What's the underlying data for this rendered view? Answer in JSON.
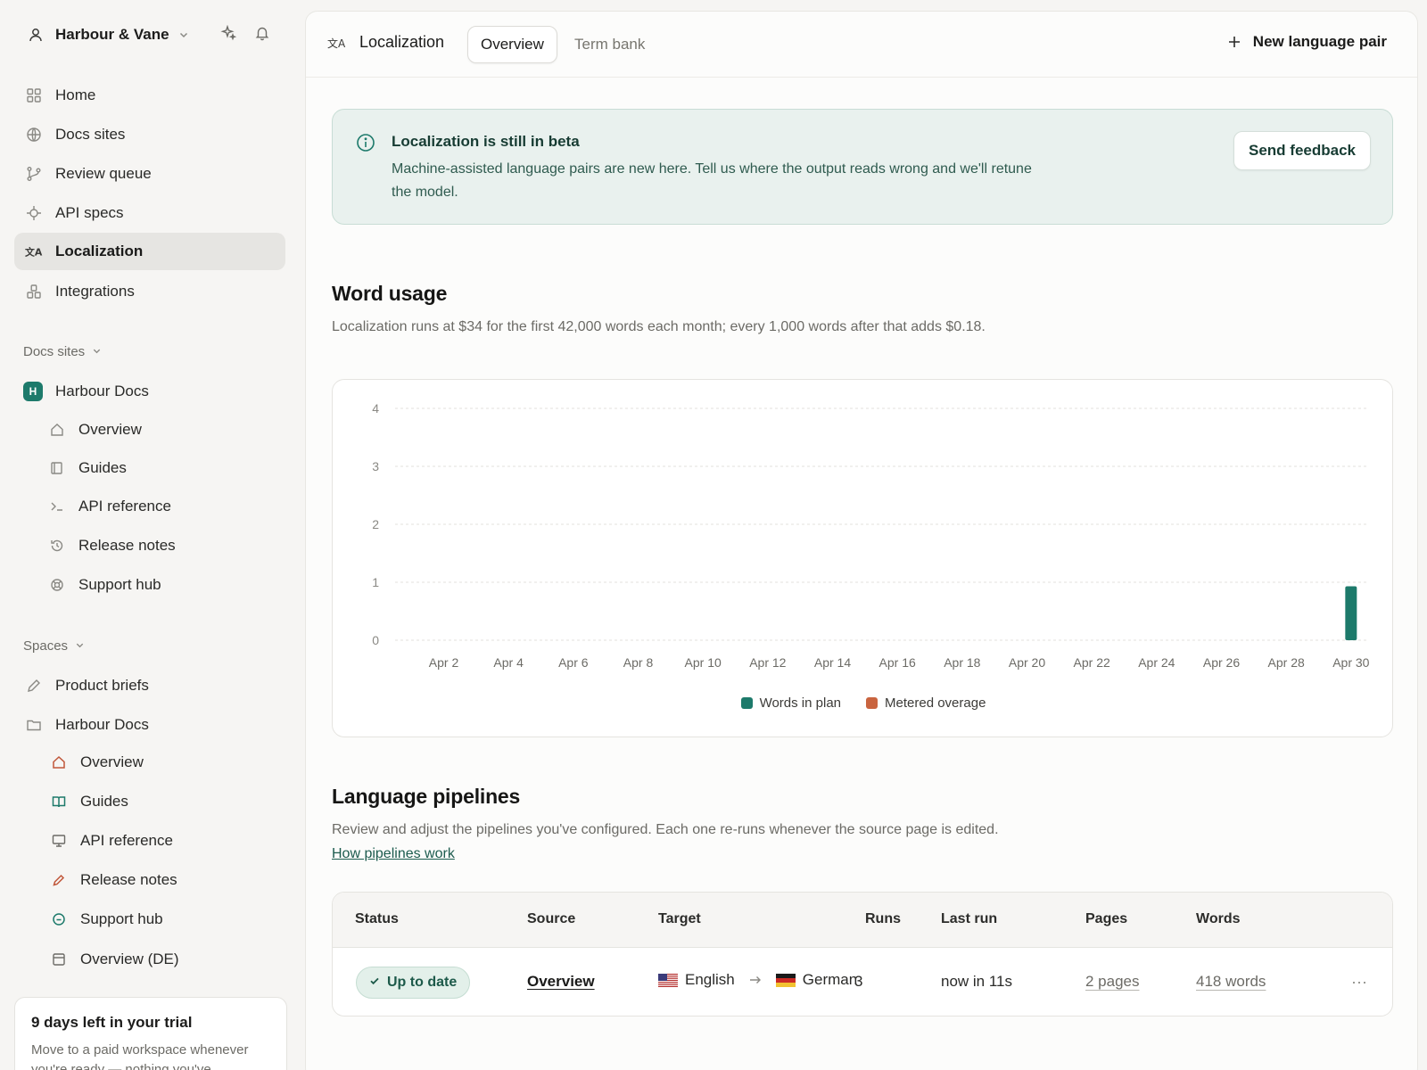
{
  "workspace": {
    "name": "Harbour & Vane"
  },
  "nav": {
    "items": [
      {
        "label": "Home",
        "icon": "grid-icon"
      },
      {
        "label": "Docs sites",
        "icon": "globe-icon"
      },
      {
        "label": "Review queue",
        "icon": "branch-icon"
      },
      {
        "label": "API specs",
        "icon": "crosshair-icon"
      },
      {
        "label": "Localization",
        "icon": "translate-icon",
        "active": true
      },
      {
        "label": "Integrations",
        "icon": "blocks-icon"
      }
    ]
  },
  "docs_sites": {
    "heading": "Docs sites",
    "site": {
      "badge": "H",
      "name": "Harbour Docs"
    },
    "pages": [
      {
        "label": "Overview",
        "icon": "home-icon"
      },
      {
        "label": "Guides",
        "icon": "book-icon"
      },
      {
        "label": "API reference",
        "icon": "terminal-icon"
      },
      {
        "label": "Release notes",
        "icon": "history-icon"
      },
      {
        "label": "Support hub",
        "icon": "lifebuoy-icon"
      }
    ]
  },
  "spaces": {
    "heading": "Spaces",
    "items": [
      {
        "label": "Product briefs",
        "icon": "pencil-icon"
      },
      {
        "label": "Harbour Docs",
        "icon": "folder-icon"
      }
    ],
    "pages": [
      {
        "label": "Overview",
        "icon": "home-icon",
        "color": "#c0573a"
      },
      {
        "label": "Guides",
        "icon": "book-icon",
        "color": "#1d7a6b"
      },
      {
        "label": "API reference",
        "icon": "monitor-icon",
        "color": "#6c6b66"
      },
      {
        "label": "Release notes",
        "icon": "pencil-icon",
        "color": "#c0573a"
      },
      {
        "label": "Support hub",
        "icon": "chat-icon",
        "color": "#1d7a6b"
      },
      {
        "label": "Overview (DE)",
        "icon": "window-icon",
        "color": "#6c6b66"
      }
    ]
  },
  "trial": {
    "title": "9 days left in your trial",
    "text": "Move to a paid workspace whenever you're ready — nothing you've"
  },
  "topbar": {
    "title": "Localization",
    "tabs": [
      {
        "label": "Overview",
        "active": true
      },
      {
        "label": "Term bank",
        "active": false
      }
    ],
    "new_pair": "New language pair"
  },
  "beta": {
    "title": "Localization is still in beta",
    "text": "Machine-assisted language pairs are new here. Tell us where the output reads wrong and we'll retune the model.",
    "button": "Send feedback"
  },
  "usage": {
    "title": "Word usage",
    "description": "Localization runs at $34 for the first 42,000 words each month; every 1,000 words after that adds $0.18."
  },
  "chart_data": {
    "type": "bar",
    "categories": [
      "Apr 1",
      "Apr 2",
      "Apr 3",
      "Apr 4",
      "Apr 5",
      "Apr 6",
      "Apr 7",
      "Apr 8",
      "Apr 9",
      "Apr 10",
      "Apr 11",
      "Apr 12",
      "Apr 13",
      "Apr 14",
      "Apr 15",
      "Apr 16",
      "Apr 17",
      "Apr 18",
      "Apr 19",
      "Apr 20",
      "Apr 21",
      "Apr 22",
      "Apr 23",
      "Apr 24",
      "Apr 25",
      "Apr 26",
      "Apr 27",
      "Apr 28",
      "Apr 29",
      "Apr 30"
    ],
    "tick_labels": [
      "Apr 2",
      "Apr 4",
      "Apr 6",
      "Apr 8",
      "Apr 10",
      "Apr 12",
      "Apr 14",
      "Apr 16",
      "Apr 18",
      "Apr 20",
      "Apr 22",
      "Apr 24",
      "Apr 26",
      "Apr 28",
      "Apr 30"
    ],
    "series": [
      {
        "name": "Words in plan",
        "color": "#1d7a6b",
        "values": [
          0,
          0,
          0,
          0,
          0,
          0,
          0,
          0,
          0,
          0,
          0,
          0,
          0,
          0,
          0,
          0,
          0,
          0,
          0,
          0,
          0,
          0,
          0,
          0,
          0,
          0,
          0,
          0,
          0,
          0.93
        ]
      },
      {
        "name": "Metered overage",
        "color": "#c9643f",
        "values": [
          0,
          0,
          0,
          0,
          0,
          0,
          0,
          0,
          0,
          0,
          0,
          0,
          0,
          0,
          0,
          0,
          0,
          0,
          0,
          0,
          0,
          0,
          0,
          0,
          0,
          0,
          0,
          0,
          0,
          0
        ]
      }
    ],
    "yticks": [
      0,
      1,
      2,
      3,
      4
    ],
    "ylim": [
      0,
      4
    ],
    "grid": true,
    "legend": "bottom-center"
  },
  "pipelines": {
    "title": "Language pipelines",
    "description": "Review and adjust the pipelines you've configured. Each one re-runs whenever the source page is edited.",
    "link": "How pipelines work",
    "columns": [
      "Status",
      "Source",
      "Target",
      "Runs",
      "Last run",
      "Pages",
      "Words"
    ],
    "rows": [
      {
        "status": "Up to date",
        "source": "Overview",
        "from_lang": "English",
        "to_lang": "German",
        "runs": "3",
        "last_run": "now in 11s",
        "pages": "2 pages",
        "words": "418 words"
      }
    ]
  }
}
